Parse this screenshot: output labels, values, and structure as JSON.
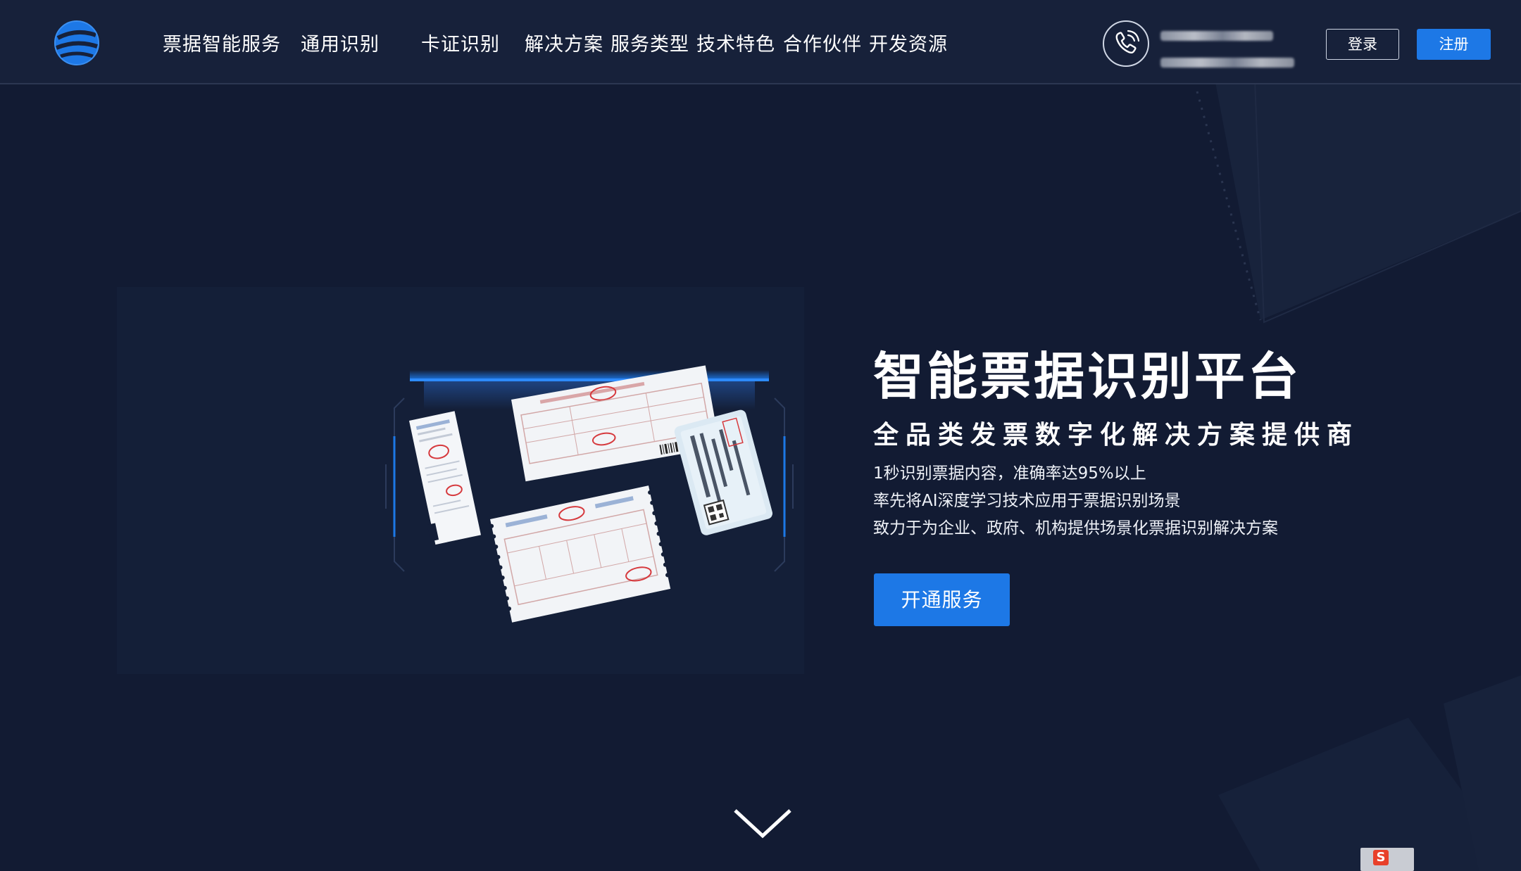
{
  "header": {
    "nav": [
      {
        "label": "票据智能服务"
      },
      {
        "label": "通用识别"
      },
      {
        "label": "卡证识别"
      },
      {
        "label": "解决方案"
      },
      {
        "label": "服务类型"
      },
      {
        "label": "技术特色"
      },
      {
        "label": "合作伙伴"
      },
      {
        "label": "开发资源"
      }
    ],
    "login_label": "登录",
    "register_label": "注册"
  },
  "hero": {
    "title": "智能票据识别平台",
    "subtitle": "全品类发票数字化解决方案提供商",
    "lines": [
      "1秒识别票据内容，准确率达95%以上",
      "率先将AI深度学习技术应用于票据识别场景",
      "致力于为企业、政府、机构提供场景化票据识别解决方案"
    ],
    "cta_label": "开通服务"
  },
  "colors": {
    "background": "#121b33",
    "header": "#17213a",
    "accent": "#1d78e6"
  },
  "icons": {
    "logo": "globe-logo-icon",
    "phone": "phone-icon",
    "scroll": "chevron-down-icon"
  }
}
